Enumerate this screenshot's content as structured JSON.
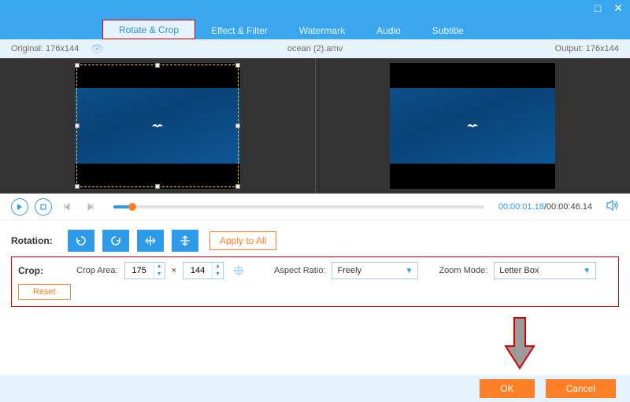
{
  "window": {
    "maximize_glyph": "□",
    "close_glyph": "✕"
  },
  "tabs": [
    "Rotate & Crop",
    "Effect & Filter",
    "Watermark",
    "Audio",
    "Subtitle"
  ],
  "infobar": {
    "original_label": "Original: 176x144",
    "filename": "ocean (2).amv",
    "output_label": "Output: 176x144"
  },
  "playbar": {
    "current_time": "00:00:01.18",
    "total_time": "/00:00:46.14"
  },
  "rotation": {
    "label": "Rotation:",
    "apply_all_label": "Apply to All"
  },
  "crop": {
    "label": "Crop:",
    "area_label": "Crop Area:",
    "width": "175",
    "height": "144",
    "mult": "×",
    "aspect_label": "Aspect Ratio:",
    "aspect_value": "Freely",
    "zoom_label": "Zoom Mode:",
    "zoom_value": "Letter Box",
    "reset_label": "Reset"
  },
  "footer": {
    "ok_label": "OK",
    "cancel_label": "Cancel"
  }
}
